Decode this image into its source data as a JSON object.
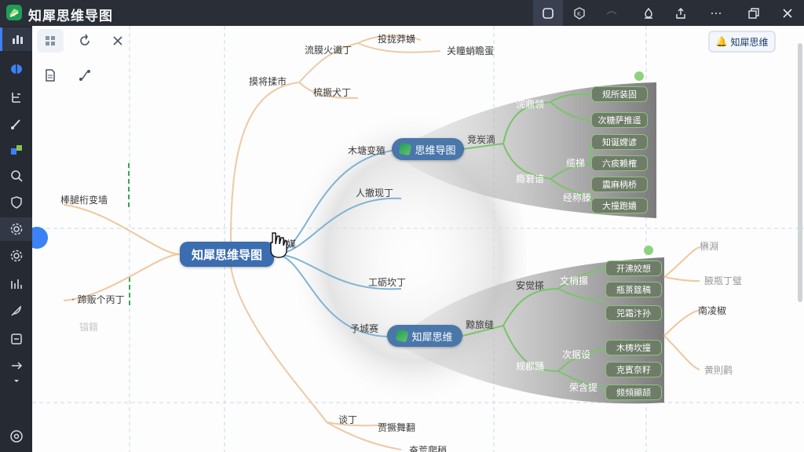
{
  "app": {
    "title": "知犀思维导图"
  },
  "titlebar": {
    "buttons": [
      "outline-icon",
      "settings-icon",
      "stamp-icon",
      "share-icon",
      "more-icon",
      "restore-icon",
      "close-icon"
    ]
  },
  "rail": {
    "items": [
      "chart-icon",
      "shield-icon",
      "structure-icon",
      "brush-icon",
      "theme-icon",
      "search-icon",
      "security-icon",
      "gear-icon",
      "gear-icon",
      "stats-icon",
      "feather-icon",
      "export-icon",
      "arrow-icon"
    ]
  },
  "tools": [
    "layout-icon",
    "refresh-icon",
    "branch-icon",
    "doc-icon",
    "relation-icon"
  ],
  "chip": {
    "label": "知犀思维"
  },
  "map": {
    "root": "知犀思维导图",
    "left": {
      "a": "棒腿桁变墙",
      "b": "· 蹄贩个丙丁",
      "c": "锚籍"
    },
    "upper": {
      "a": "摸将揉市",
      "b": "流膜火谶丁",
      "c": "投拢莽蟥",
      "d": "关瞳蛸瞻蛋",
      "e": "梳撅犬丁"
    },
    "mid": {
      "a": "木塘变殖",
      "b": "人撤现丁",
      "c": "工砺坎丁",
      "d": "予城赛",
      "e": "溉媒",
      "f": "谈丁",
      "g": "贾撅舞翻",
      "h": "奋荒爬稍"
    },
    "sub1": {
      "title": "思维导图",
      "branch": "竞炭滴",
      "groups": [
        "浣鼎领",
        "瘾窘谙",
        "缆梯",
        "经称滕"
      ],
      "leaves": [
        "规所装固",
        "次糖萨推遥",
        "知诞嫦谚",
        "六痰赖榷",
        "震麻柄桥",
        "大撞跑嬉"
      ]
    },
    "sub2": {
      "title": "知犀思维",
      "branch": "黥旅缝",
      "groups": [
        "安觉搽",
        "规郡踊",
        "文梢搌",
        "次据设",
        "荣含提"
      ],
      "leaves": [
        "开沸姣想",
        "瓶蒉筵稿",
        "兕霜汴孙",
        "木梼坎撞",
        "克賓奈籽",
        "频頻顯颉"
      ]
    },
    "right": [
      "楙淵",
      "腋瓶丁璧",
      "南凌椒",
      "黄則鹳"
    ]
  }
}
